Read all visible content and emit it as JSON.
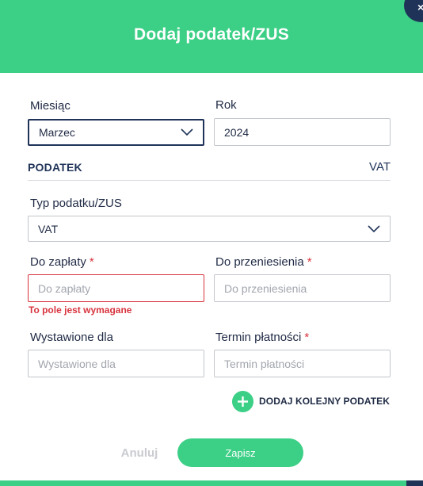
{
  "modal": {
    "title": "Dodaj podatek/ZUS",
    "close_label": "×"
  },
  "month": {
    "label": "Miesiąc",
    "value": "Marzec"
  },
  "year": {
    "label": "Rok",
    "value": "2024"
  },
  "section": {
    "title": "PODATEK",
    "right": "VAT"
  },
  "tax_type": {
    "label": "Typ podatku/ZUS",
    "value": "VAT"
  },
  "to_pay": {
    "label": "Do zapłaty",
    "required_mark": "*",
    "placeholder": "Do zapłaty",
    "error": "To pole jest wymagane"
  },
  "transfer": {
    "label": "Do przeniesienia",
    "required_mark": "*",
    "placeholder": "Do przeniesienia"
  },
  "issued_for": {
    "label": "Wystawione dla",
    "placeholder": "Wystawione dla"
  },
  "due_date": {
    "label": "Termin płatności",
    "required_mark": "*",
    "placeholder": "Termin płatności"
  },
  "add_tax": {
    "label": "DODAJ KOLEJNY PODATEK",
    "icon": "plus-icon"
  },
  "actions": {
    "cancel": "Anuluj",
    "save": "Zapisz"
  },
  "colors": {
    "accent": "#3ccf86",
    "navy": "#1f3358",
    "error": "#d8343e",
    "muted": "#c9cbd0"
  }
}
